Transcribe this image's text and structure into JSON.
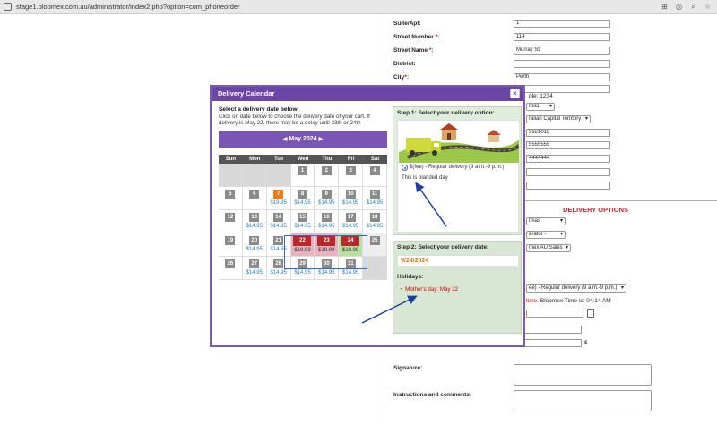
{
  "browser": {
    "url": "stage1.bloomex.com.au/administrator/index2.php?option=com_phoneorder"
  },
  "form": {
    "suite_label": "Suite/Apt:",
    "suite_value": "1",
    "street_number_label": "Street Number",
    "street_number_value": "114",
    "street_name_label": "Street Name",
    "street_name_value": "Murray St",
    "district_label": "District:",
    "city_label": "City",
    "city_value": "Perth",
    "sample_text": "ple: 1234",
    "country_value": "ralia",
    "state_value": "ralian Capital Territory",
    "phone1": "9921018",
    "phone2": "5555555",
    "phone3": "4444444",
    "delivery_options_heading": "DELIVERY OPTIONS",
    "occasion_value": "tmas",
    "operator_value": "erator -",
    "sales_value": "mex AU Sales",
    "delivery_method_value": "ee) - Regular delivery (9 a.m.-9 p.m.)",
    "time_red": "time.",
    "bloomex_time_label": "Bloomex Time is: 04:14 AM",
    "dollar_sign": "$",
    "signature_label": "Signature:",
    "instructions_label": "Instructions and comments:"
  },
  "modal": {
    "title": "Delivery Calendar",
    "close": "×",
    "instructions_title": "Select a delivery date below",
    "instructions_text": "Click on date below to choose the delivery date of your cart. If delivery is May 22, there may be a delay until 23th or 24th",
    "month_label": "May 2024",
    "prev": "◀",
    "next": "▶",
    "weekdays": [
      "Sun",
      "Mon",
      "Tue",
      "Wed",
      "Thu",
      "Fri",
      "Sat"
    ],
    "step1_title": "Step 1: Select your delivery option:",
    "delivery_option_label": "$(fee) - Regular delivery (9 a.m.-9 p.m.)",
    "blended_note": "This is blanded day",
    "step2_title": "Step 2: Select your delivery date:",
    "selected_date": "5/24/2024",
    "holidays_label": "Holidays:",
    "holiday_item": "Mother's day: May 22"
  },
  "calendar": {
    "weeks": [
      [
        {
          "d": ""
        },
        {
          "d": ""
        },
        {
          "d": ""
        },
        {
          "d": "1"
        },
        {
          "d": "2"
        },
        {
          "d": "3"
        },
        {
          "d": "4"
        }
      ],
      [
        {
          "d": "5"
        },
        {
          "d": "6"
        },
        {
          "d": "7",
          "p": "$19.95",
          "s": "orange"
        },
        {
          "d": "8",
          "p": "$14.95"
        },
        {
          "d": "9",
          "p": "$14.95"
        },
        {
          "d": "10",
          "p": "$14.95"
        },
        {
          "d": "11",
          "p": "$14.95"
        }
      ],
      [
        {
          "d": "12"
        },
        {
          "d": "13",
          "p": "$14.95"
        },
        {
          "d": "14",
          "p": "$14.95"
        },
        {
          "d": "15",
          "p": "$14.95"
        },
        {
          "d": "16",
          "p": "$14.95"
        },
        {
          "d": "17",
          "p": "$14.95"
        },
        {
          "d": "18",
          "p": "$14.95"
        }
      ],
      [
        {
          "d": "19"
        },
        {
          "d": "20",
          "p": "$14.95"
        },
        {
          "d": "21",
          "p": "$14.95"
        },
        {
          "d": "22",
          "p": "$19.99",
          "s": "pink"
        },
        {
          "d": "23",
          "p": "$19.99",
          "s": "pink"
        },
        {
          "d": "24",
          "p": "$19.99",
          "s": "green"
        },
        {
          "d": "25",
          "s": "dim"
        }
      ],
      [
        {
          "d": "26"
        },
        {
          "d": "27",
          "p": "$14.95"
        },
        {
          "d": "28",
          "p": "$14.95"
        },
        {
          "d": "29",
          "p": "$14.95"
        },
        {
          "d": "30",
          "p": "$14.95"
        },
        {
          "d": "31",
          "p": "$14.95"
        },
        {
          "d": "",
          "s": "empty"
        }
      ]
    ]
  },
  "colors": {
    "header_purple": "#6b46a8",
    "orange": "#f07a16",
    "holiday_red": "#b8282b",
    "price_blue": "#1f7cbd",
    "arrow_blue": "#1e3e9c"
  }
}
